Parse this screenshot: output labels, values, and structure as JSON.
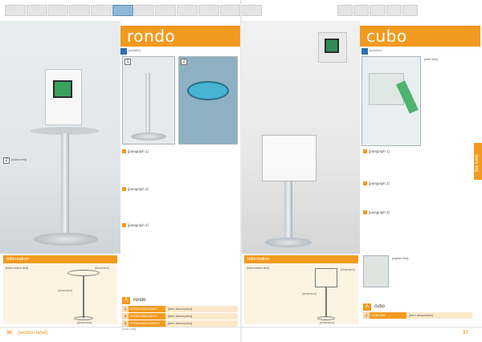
{
  "left_page": {
    "title": "rondo",
    "subtitle": "[subtitle]",
    "body_paragraph_1": "[paragraph 1]",
    "body_paragraph_2": "[paragraph 2]",
    "body_paragraph_3": "[paragraph 3]",
    "callout_number": "2",
    "callout_text": "[callout text]",
    "inset_1_number": "1",
    "inset_2_number": "2",
    "information_heading": "Information",
    "information_text": "[information text]",
    "spec_labels": [
      "[dimension]",
      "[dimension]",
      "[dimension]"
    ],
    "order": {
      "tag": "A",
      "title": "rondo",
      "rows": [
        {
          "num": "1",
          "code": "STERONDOVIDE*",
          "desc": "[item description]"
        },
        {
          "num": "2",
          "code": "STERONDOINFO*",
          "desc": "[item description]"
        },
        {
          "num": "3",
          "code": "STERONDOVIDEO*",
          "desc": "[item description]"
        }
      ],
      "footnote": "[order note]"
    },
    "footer_page_num": "36",
    "footer_label": "[section label]"
  },
  "right_page": {
    "title": "cubo",
    "subtitle": "[subtitle]",
    "side_note": "[side note]",
    "body_paragraph_1": "[paragraph 1]",
    "body_paragraph_2": "[paragraph 2]",
    "body_paragraph_3": "[paragraph 3]",
    "caption_text": "[caption text]",
    "information_heading": "Information",
    "information_text": "[information text]",
    "spec_labels": [
      "[dimension]",
      "[dimension]",
      "[dimension]"
    ],
    "order": {
      "tag": "A",
      "title": "cubo",
      "rows": [
        {
          "num": "1",
          "code": "CUBO250",
          "desc": "[item description]"
        }
      ]
    },
    "footer_page_num": "37",
    "side_tab_label": "[tab label]"
  },
  "colors": {
    "accent": "#f29a1f",
    "accent_light": "#fdf3e3",
    "accent_blue": "#2b6fb0"
  }
}
